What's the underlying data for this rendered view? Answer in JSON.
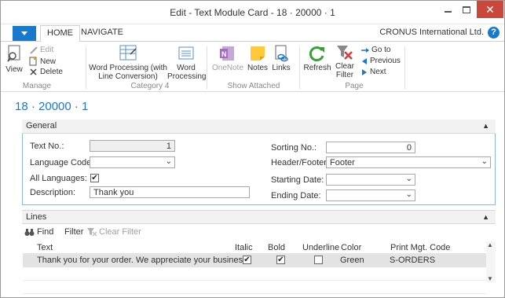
{
  "window": {
    "title": "Edit - Text Module Card - 18 · 20000 · 1",
    "close_glyph": "✕"
  },
  "ribbon_tabs": {
    "home": "HOME",
    "navigate": "NAVIGATE"
  },
  "company": "CRONUS International Ltd.",
  "help": "?",
  "ribbon": {
    "manage": {
      "view": "View",
      "edit": "Edit",
      "new": "New",
      "delete": "Delete",
      "group": "Manage"
    },
    "category4": {
      "word_conv_line1": "Word Processing (with",
      "word_conv_line2": "Line Conversion)",
      "word_line1": "Word",
      "word_line2": "Processing",
      "group": "Category 4"
    },
    "show_attached": {
      "onenote": "OneNote",
      "notes": "Notes",
      "links": "Links",
      "group": "Show Attached"
    },
    "page": {
      "refresh": "Refresh",
      "clear_filter_line1": "Clear",
      "clear_filter_line2": "Filter",
      "go_to": "Go to",
      "previous": "Previous",
      "next": "Next",
      "group": "Page"
    }
  },
  "page_header": "18 · 20000 · 1",
  "general": {
    "title": "General",
    "text_no_label": "Text No.:",
    "text_no_value": "1",
    "language_code_label": "Language Code:",
    "language_code_value": "",
    "all_languages_label": "All Languages:",
    "all_languages_checked": "✔",
    "description_label": "Description:",
    "description_value": "Thank you",
    "sorting_no_label": "Sorting No.:",
    "sorting_no_value": "0",
    "header_footer_label": "Header/Footer:",
    "header_footer_value": "Footer",
    "starting_date_label": "Starting Date:",
    "starting_date_value": "",
    "ending_date_label": "Ending Date:",
    "ending_date_value": ""
  },
  "lines": {
    "title": "Lines",
    "find": "Find",
    "filter": "Filter",
    "clear_filter": "Clear Filter",
    "columns": {
      "text": "Text",
      "italic": "Italic",
      "bold": "Bold",
      "underline": "Underline",
      "color": "Color",
      "print_code": "Print Mgt. Code"
    },
    "rows": [
      {
        "text": "Thank you for your order. We appreciate your business.",
        "italic": "✔",
        "bold": "✔",
        "underline": "",
        "color": "Green",
        "print_code": "S-ORDERS"
      }
    ]
  },
  "colors": {
    "accent": "#1979ca",
    "close": "#c9473b",
    "selected_row": "#e3e3e3"
  }
}
